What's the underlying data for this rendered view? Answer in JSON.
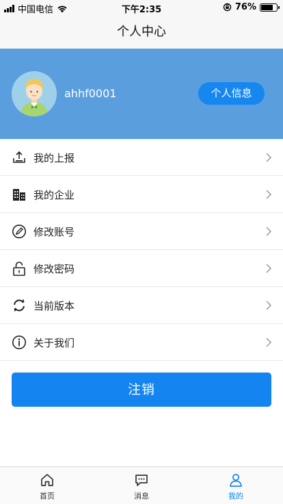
{
  "status_bar": {
    "carrier": "中国电信",
    "time": "下午2:35",
    "battery": "76%",
    "battery_level": 0.76
  },
  "header": {
    "title": "个人中心"
  },
  "profile": {
    "username": "ahhf0001",
    "info_button": "个人信息",
    "avatar_icon": "user-avatar-icon"
  },
  "menu": {
    "items": [
      {
        "label": "我的上报",
        "icon": "upload-icon"
      },
      {
        "label": "我的企业",
        "icon": "building-icon"
      },
      {
        "label": "修改账号",
        "icon": "edit-pen-icon"
      },
      {
        "label": "修改密码",
        "icon": "unlock-icon"
      },
      {
        "label": "当前版本",
        "icon": "refresh-icon"
      },
      {
        "label": "关于我们",
        "icon": "info-icon"
      }
    ]
  },
  "logout_button": "注销",
  "tabbar": {
    "tabs": [
      {
        "label": "首页",
        "icon": "home-icon"
      },
      {
        "label": "消息",
        "icon": "message-icon"
      },
      {
        "label": "我的",
        "icon": "person-icon"
      }
    ],
    "active_color": "#1384f0"
  },
  "colors": {
    "banner": "#5a9ede",
    "accent": "#1384f0"
  }
}
